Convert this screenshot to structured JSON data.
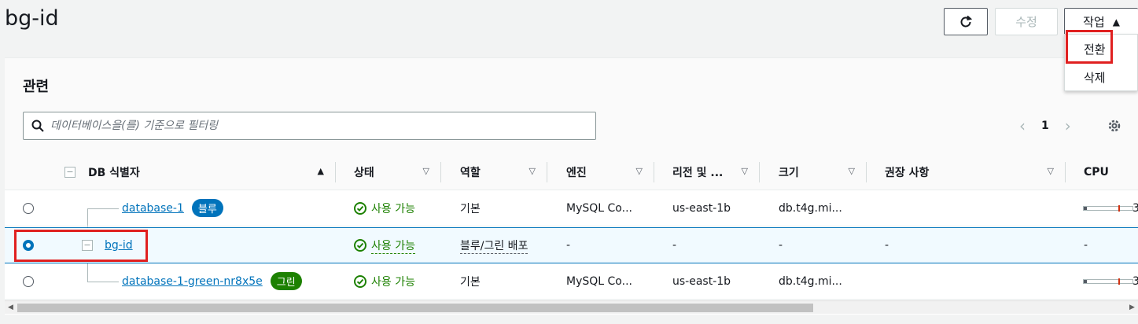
{
  "header": {
    "title": "bg-id"
  },
  "toolbar": {
    "refresh_icon": "refresh-icon",
    "edit_label": "수정",
    "actions_label": "작업",
    "actions_caret": "▲"
  },
  "actions_menu": {
    "items": [
      "전환",
      "삭제"
    ]
  },
  "panel": {
    "title": "관련",
    "search_placeholder": "데이터베이스을(를) 기준으로 필터링",
    "pagination": {
      "prev": "‹",
      "page": "1",
      "next": "›"
    }
  },
  "table": {
    "expander": "−",
    "columns": [
      "DB 식별자",
      "상태",
      "역할",
      "엔진",
      "리전 및 ...",
      "크기",
      "권장 사항",
      "CPU"
    ],
    "sort_indicator": "▲",
    "sort_caret": "▽",
    "rows": [
      {
        "id": "database-1",
        "badge": "블루",
        "status": "사용 가능",
        "role": "기본",
        "engine": "MySQL Co...",
        "region": "us-east-1b",
        "size": "db.t4g.mi...",
        "recommendation": "",
        "cpu": "3"
      },
      {
        "id": "bg-id",
        "badge": "",
        "status": "사용 가능",
        "role": "블루/그린 배포",
        "engine": "-",
        "region": "-",
        "size": "-",
        "recommendation": "-",
        "cpu": "-"
      },
      {
        "id": "database-1-green-nr8x5e",
        "badge": "그린",
        "status": "사용 가능",
        "role": "기본",
        "engine": "MySQL Co...",
        "region": "us-east-1b",
        "size": "db.t4g.mi...",
        "recommendation": "",
        "cpu": "3"
      }
    ]
  },
  "scrollbar": {
    "left_arrow": "◀",
    "right_arrow": "▶"
  },
  "colors": {
    "link": "#0073bb",
    "success": "#1d8102",
    "highlight": "#e02020"
  }
}
